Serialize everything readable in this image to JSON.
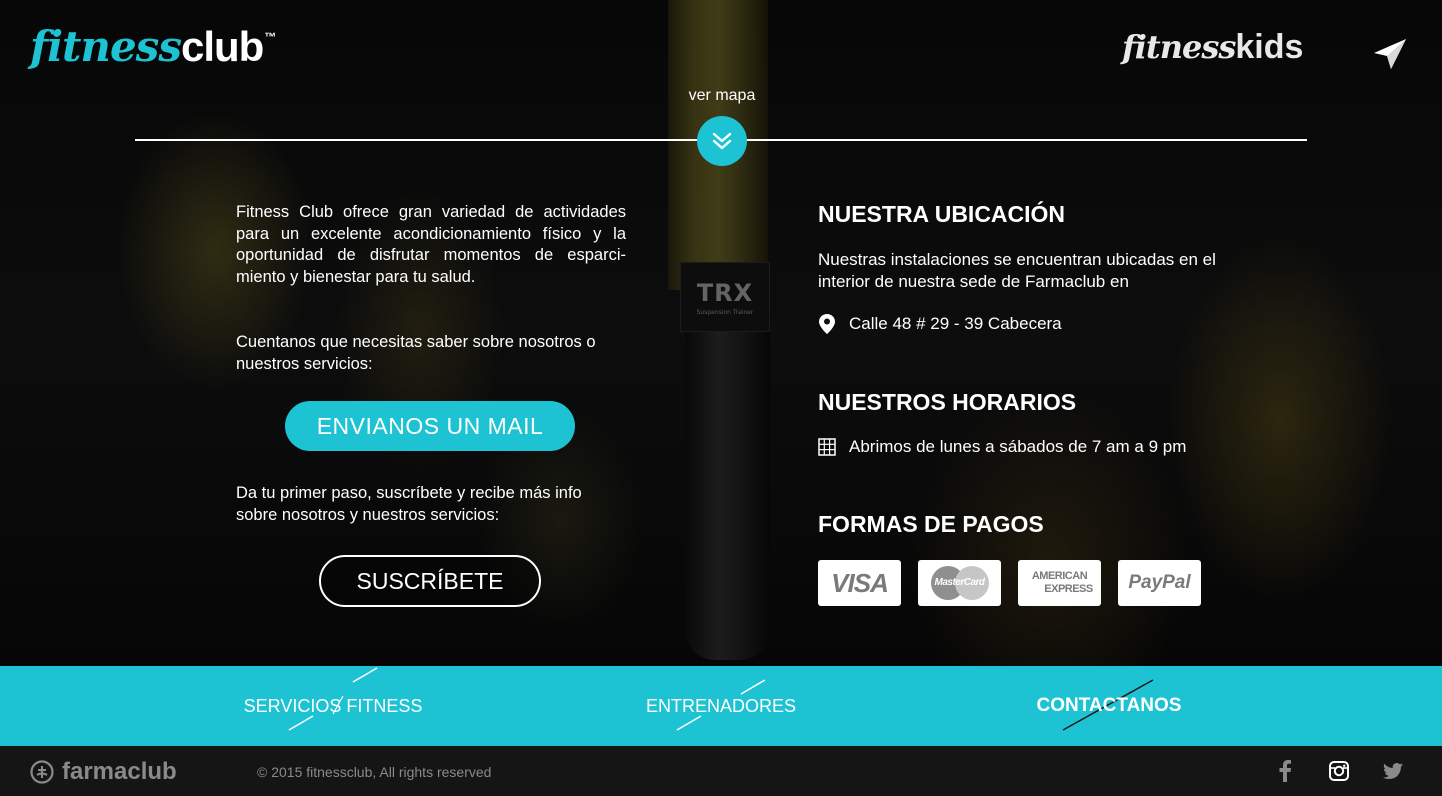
{
  "brand": {
    "logo_word1": "fitness",
    "logo_word2": "club",
    "logo_tm": "™",
    "kids_word1": "fitness",
    "kids_word2": "kids",
    "accent_color": "#1dc3d3"
  },
  "map": {
    "label": "ver mapa"
  },
  "left": {
    "intro": "Fitness Club ofrece gran variedad de actividades para un excelente acondicionamiento físico y la oportunidad de disfrutar momentos de esparci-miento y bienestar para tu salud.",
    "ask": "Cuentanos que necesitas saber sobre nosotros o nuestros servicios:",
    "mail_button": "ENVIANOS UN MAIL",
    "subscribe_text": "Da tu primer paso, suscríbete y recibe más info sobre nosotros y nuestros servicios:",
    "subscribe_button": "SUSCRÍBETE"
  },
  "right": {
    "location_title": "NUESTRA UBICACIÓN",
    "location_text": "Nuestras instalaciones se encuentran ubicadas en el interior de nuestra sede de Farmaclub en",
    "address": "Calle 48 # 29 - 39 Cabecera",
    "hours_title": "NUESTROS HORARIOS",
    "hours_text": "Abrimos de lunes a sábados de 7 am a 9 pm",
    "payments_title": "FORMAS DE PAGOS",
    "payments": {
      "visa": "VISA",
      "mastercard": "MasterCard",
      "amex_line1": "AMERICAN",
      "amex_line2": "EXPRESS",
      "paypal": "PayPal"
    }
  },
  "nav": {
    "items": [
      {
        "label": "SERVICIOS FITNESS"
      },
      {
        "label": "ENTRENADORES"
      },
      {
        "label": "CONTACTANOS",
        "active": true
      }
    ]
  },
  "footer": {
    "farmaclub": "farmaclub",
    "copyright": "© 2015 fitnessclub, All rights reserved",
    "social_icons": [
      "facebook-icon",
      "instagram-icon",
      "twitter-icon"
    ]
  },
  "background_badge": {
    "brand": "TRX",
    "sub": "Suspension Trainer"
  }
}
